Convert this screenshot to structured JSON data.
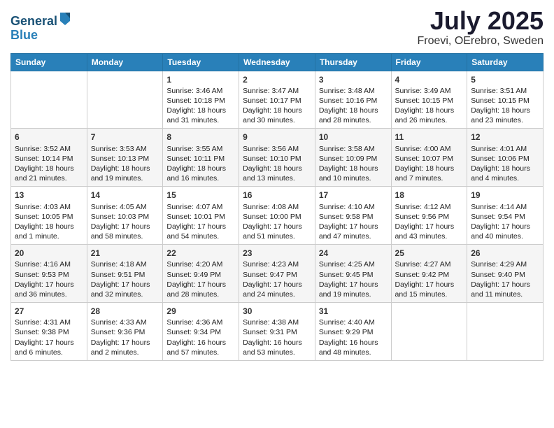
{
  "header": {
    "logo_line1": "General",
    "logo_line2": "Blue",
    "title": "July 2025",
    "subtitle": "Froevi, OErebro, Sweden"
  },
  "days_of_week": [
    "Sunday",
    "Monday",
    "Tuesday",
    "Wednesday",
    "Thursday",
    "Friday",
    "Saturday"
  ],
  "weeks": [
    [
      {
        "day": "",
        "content": ""
      },
      {
        "day": "",
        "content": ""
      },
      {
        "day": "1",
        "content": "Sunrise: 3:46 AM\nSunset: 10:18 PM\nDaylight: 18 hours and 31 minutes."
      },
      {
        "day": "2",
        "content": "Sunrise: 3:47 AM\nSunset: 10:17 PM\nDaylight: 18 hours and 30 minutes."
      },
      {
        "day": "3",
        "content": "Sunrise: 3:48 AM\nSunset: 10:16 PM\nDaylight: 18 hours and 28 minutes."
      },
      {
        "day": "4",
        "content": "Sunrise: 3:49 AM\nSunset: 10:15 PM\nDaylight: 18 hours and 26 minutes."
      },
      {
        "day": "5",
        "content": "Sunrise: 3:51 AM\nSunset: 10:15 PM\nDaylight: 18 hours and 23 minutes."
      }
    ],
    [
      {
        "day": "6",
        "content": "Sunrise: 3:52 AM\nSunset: 10:14 PM\nDaylight: 18 hours and 21 minutes."
      },
      {
        "day": "7",
        "content": "Sunrise: 3:53 AM\nSunset: 10:13 PM\nDaylight: 18 hours and 19 minutes."
      },
      {
        "day": "8",
        "content": "Sunrise: 3:55 AM\nSunset: 10:11 PM\nDaylight: 18 hours and 16 minutes."
      },
      {
        "day": "9",
        "content": "Sunrise: 3:56 AM\nSunset: 10:10 PM\nDaylight: 18 hours and 13 minutes."
      },
      {
        "day": "10",
        "content": "Sunrise: 3:58 AM\nSunset: 10:09 PM\nDaylight: 18 hours and 10 minutes."
      },
      {
        "day": "11",
        "content": "Sunrise: 4:00 AM\nSunset: 10:07 PM\nDaylight: 18 hours and 7 minutes."
      },
      {
        "day": "12",
        "content": "Sunrise: 4:01 AM\nSunset: 10:06 PM\nDaylight: 18 hours and 4 minutes."
      }
    ],
    [
      {
        "day": "13",
        "content": "Sunrise: 4:03 AM\nSunset: 10:05 PM\nDaylight: 18 hours and 1 minute."
      },
      {
        "day": "14",
        "content": "Sunrise: 4:05 AM\nSunset: 10:03 PM\nDaylight: 17 hours and 58 minutes."
      },
      {
        "day": "15",
        "content": "Sunrise: 4:07 AM\nSunset: 10:01 PM\nDaylight: 17 hours and 54 minutes."
      },
      {
        "day": "16",
        "content": "Sunrise: 4:08 AM\nSunset: 10:00 PM\nDaylight: 17 hours and 51 minutes."
      },
      {
        "day": "17",
        "content": "Sunrise: 4:10 AM\nSunset: 9:58 PM\nDaylight: 17 hours and 47 minutes."
      },
      {
        "day": "18",
        "content": "Sunrise: 4:12 AM\nSunset: 9:56 PM\nDaylight: 17 hours and 43 minutes."
      },
      {
        "day": "19",
        "content": "Sunrise: 4:14 AM\nSunset: 9:54 PM\nDaylight: 17 hours and 40 minutes."
      }
    ],
    [
      {
        "day": "20",
        "content": "Sunrise: 4:16 AM\nSunset: 9:53 PM\nDaylight: 17 hours and 36 minutes."
      },
      {
        "day": "21",
        "content": "Sunrise: 4:18 AM\nSunset: 9:51 PM\nDaylight: 17 hours and 32 minutes."
      },
      {
        "day": "22",
        "content": "Sunrise: 4:20 AM\nSunset: 9:49 PM\nDaylight: 17 hours and 28 minutes."
      },
      {
        "day": "23",
        "content": "Sunrise: 4:23 AM\nSunset: 9:47 PM\nDaylight: 17 hours and 24 minutes."
      },
      {
        "day": "24",
        "content": "Sunrise: 4:25 AM\nSunset: 9:45 PM\nDaylight: 17 hours and 19 minutes."
      },
      {
        "day": "25",
        "content": "Sunrise: 4:27 AM\nSunset: 9:42 PM\nDaylight: 17 hours and 15 minutes."
      },
      {
        "day": "26",
        "content": "Sunrise: 4:29 AM\nSunset: 9:40 PM\nDaylight: 17 hours and 11 minutes."
      }
    ],
    [
      {
        "day": "27",
        "content": "Sunrise: 4:31 AM\nSunset: 9:38 PM\nDaylight: 17 hours and 6 minutes."
      },
      {
        "day": "28",
        "content": "Sunrise: 4:33 AM\nSunset: 9:36 PM\nDaylight: 17 hours and 2 minutes."
      },
      {
        "day": "29",
        "content": "Sunrise: 4:36 AM\nSunset: 9:34 PM\nDaylight: 16 hours and 57 minutes."
      },
      {
        "day": "30",
        "content": "Sunrise: 4:38 AM\nSunset: 9:31 PM\nDaylight: 16 hours and 53 minutes."
      },
      {
        "day": "31",
        "content": "Sunrise: 4:40 AM\nSunset: 9:29 PM\nDaylight: 16 hours and 48 minutes."
      },
      {
        "day": "",
        "content": ""
      },
      {
        "day": "",
        "content": ""
      }
    ]
  ]
}
